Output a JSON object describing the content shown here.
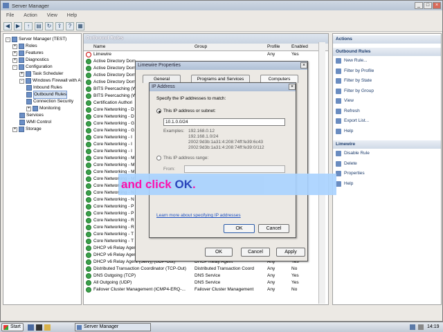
{
  "window": {
    "title": "Server Manager"
  },
  "menu": [
    "File",
    "Action",
    "View",
    "Help"
  ],
  "tree": [
    {
      "label": "Server Manager (TEST)",
      "indent": 0,
      "expander": "-"
    },
    {
      "label": "Roles",
      "indent": 1,
      "expander": "+"
    },
    {
      "label": "Features",
      "indent": 1,
      "expander": "+"
    },
    {
      "label": "Diagnostics",
      "indent": 1,
      "expander": "+"
    },
    {
      "label": "Configuration",
      "indent": 1,
      "expander": "-"
    },
    {
      "label": "Task Scheduler",
      "indent": 2,
      "expander": "+"
    },
    {
      "label": "Windows Firewall with A",
      "indent": 2,
      "expander": "-"
    },
    {
      "label": "Inbound Rules",
      "indent": 3,
      "expander": ""
    },
    {
      "label": "Outbound Rules",
      "indent": 3,
      "expander": "",
      "selected": true
    },
    {
      "label": "Connection Security",
      "indent": 3,
      "expander": ""
    },
    {
      "label": "Monitoring",
      "indent": 3,
      "expander": "+"
    },
    {
      "label": "Services",
      "indent": 2,
      "expander": ""
    },
    {
      "label": "WMI Control",
      "indent": 2,
      "expander": ""
    },
    {
      "label": "Storage",
      "indent": 1,
      "expander": "+"
    }
  ],
  "center": {
    "header": "Outbound Rules",
    "columns": [
      "Name",
      "Group",
      "Profile",
      "Enabled",
      "Ac"
    ],
    "rows": [
      {
        "name": "Limewire",
        "group": "",
        "profile": "Any",
        "enabled": "Yes",
        "action": "",
        "blocked": true
      },
      {
        "name": "Active Directory Dom",
        "group": "",
        "profile": "",
        "enabled": "",
        "action": "A"
      },
      {
        "name": "Active Directory Dom",
        "group": "",
        "profile": "",
        "enabled": "",
        "action": "A"
      },
      {
        "name": "Active Directory Dom",
        "group": "",
        "profile": "",
        "enabled": "",
        "action": "A"
      },
      {
        "name": "Active Directory Dom",
        "group": "",
        "profile": "",
        "enabled": "",
        "action": "A"
      },
      {
        "name": "BITS Peercaching (W",
        "group": "",
        "profile": "",
        "enabled": "",
        "action": "A"
      },
      {
        "name": "BITS Peercaching (W",
        "group": "",
        "profile": "",
        "enabled": "",
        "action": "A"
      },
      {
        "name": "Certification Authori",
        "group": "",
        "profile": "",
        "enabled": "",
        "action": "A"
      },
      {
        "name": "Core Networking - D",
        "group": "",
        "profile": "",
        "enabled": "",
        "action": "A"
      },
      {
        "name": "Core Networking - D",
        "group": "",
        "profile": "",
        "enabled": "",
        "action": "A"
      },
      {
        "name": "Core Networking - G",
        "group": "",
        "profile": "",
        "enabled": "",
        "action": "A"
      },
      {
        "name": "Core Networking - G",
        "group": "",
        "profile": "",
        "enabled": "",
        "action": "A"
      },
      {
        "name": "Core Networking - I",
        "group": "",
        "profile": "",
        "enabled": "",
        "action": "A"
      },
      {
        "name": "Core Networking - I",
        "group": "",
        "profile": "",
        "enabled": "",
        "action": "A"
      },
      {
        "name": "Core Networking - I",
        "group": "",
        "profile": "",
        "enabled": "",
        "action": "A"
      },
      {
        "name": "Core Networking - M",
        "group": "",
        "profile": "",
        "enabled": "",
        "action": "A"
      },
      {
        "name": "Core Networking - M",
        "group": "",
        "profile": "",
        "enabled": "",
        "action": "A"
      },
      {
        "name": "Core Networking - M",
        "group": "",
        "profile": "",
        "enabled": "",
        "action": "A"
      },
      {
        "name": "Core Networking - M",
        "group": "",
        "profile": "",
        "enabled": "",
        "action": "A"
      },
      {
        "name": "Core Networking - M",
        "group": "",
        "profile": "",
        "enabled": "",
        "action": "A"
      },
      {
        "name": "Core Networking - N",
        "group": "",
        "profile": "",
        "enabled": "",
        "action": "A"
      },
      {
        "name": "Core Networking - N",
        "group": "",
        "profile": "",
        "enabled": "",
        "action": "A"
      },
      {
        "name": "Core Networking - P",
        "group": "",
        "profile": "",
        "enabled": "",
        "action": "A"
      },
      {
        "name": "Core Networking - P",
        "group": "",
        "profile": "",
        "enabled": "",
        "action": "A"
      },
      {
        "name": "Core Networking - R",
        "group": "",
        "profile": "",
        "enabled": "",
        "action": "A"
      },
      {
        "name": "Core Networking - R",
        "group": "",
        "profile": "",
        "enabled": "",
        "action": "A"
      },
      {
        "name": "Core Networking - T",
        "group": "",
        "profile": "",
        "enabled": "",
        "action": "A"
      },
      {
        "name": "Core Networking - T",
        "group": "",
        "profile": "",
        "enabled": "",
        "action": "A"
      },
      {
        "name": "DHCP v6 Relay Agen",
        "group": "",
        "profile": "",
        "enabled": "",
        "action": "A"
      },
      {
        "name": "DHCP v6 Relay Agent (DHCPv6-Out)",
        "group": "DHCP Relay Agent",
        "profile": "Any",
        "enabled": "Yes",
        "action": "A"
      },
      {
        "name": "DHCP v6 Relay Agent (Serv)) (UDP-Out)",
        "group": "DHCP Relay Agent",
        "profile": "Any",
        "enabled": "Yes",
        "action": "A"
      },
      {
        "name": "Distributed Transaction Coordinator (TCP-Out)",
        "group": "Distributed Transaction Coord",
        "profile": "Any",
        "enabled": "No",
        "action": "A"
      },
      {
        "name": "DNS Outgoing (TCP)",
        "group": "DNS Service",
        "profile": "Any",
        "enabled": "Yes",
        "action": "A"
      },
      {
        "name": "All Outgoing (UDP)",
        "group": "DNS Service",
        "profile": "Any",
        "enabled": "Yes",
        "action": "A"
      },
      {
        "name": "Failover Cluster Management (ICMP4-ERQ-...",
        "group": "Failover Cluster Management",
        "profile": "Any",
        "enabled": "No",
        "action": "A"
      },
      {
        "name": "",
        "group": "",
        "profile": "",
        "enabled": "",
        "action": ""
      }
    ]
  },
  "actions": {
    "sections": [
      {
        "header": "Actions",
        "items": []
      },
      {
        "header": "Outbound Rules",
        "items": [
          "New Rule...",
          "Filter by Profile",
          "Filter by State",
          "Filter by Group",
          "View",
          "Refresh",
          "Export List...",
          "Help"
        ]
      },
      {
        "header": "Limewire",
        "items": [
          "Disable Rule",
          "Delete",
          "Properties",
          "Help"
        ]
      }
    ]
  },
  "props_dialog": {
    "title": "Limewire Properties",
    "tabs": [
      "General",
      "Programs and Services",
      "Computers"
    ],
    "ok": "OK",
    "cancel": "Cancel",
    "apply": "Apply"
  },
  "ip_dialog": {
    "title": "IP Address",
    "intro": "Specify the IP addresses to match:",
    "option_subnet": "This IP address or subnet:",
    "subnet_value": "10.1.0.0/24",
    "examples_label": "Examples:",
    "examples": [
      "192.168.0.12",
      "192.168.1.0/24",
      "2002:9d3b:1a31:4:208:74ff:fe39:6c43",
      "2002:9d3b:1a31:4:208:74ff:fe39:0/112"
    ],
    "option_range": "This IP address range:",
    "from_label": "From:",
    "link": "Learn more about specifying IP addresses",
    "ok": "OK",
    "cancel": "Cancel"
  },
  "banner": {
    "part1": "and click ",
    "part2": "OK",
    "part3": "."
  },
  "taskbar": {
    "start": "Start",
    "task": "Server Manager",
    "clock": "14:19"
  }
}
